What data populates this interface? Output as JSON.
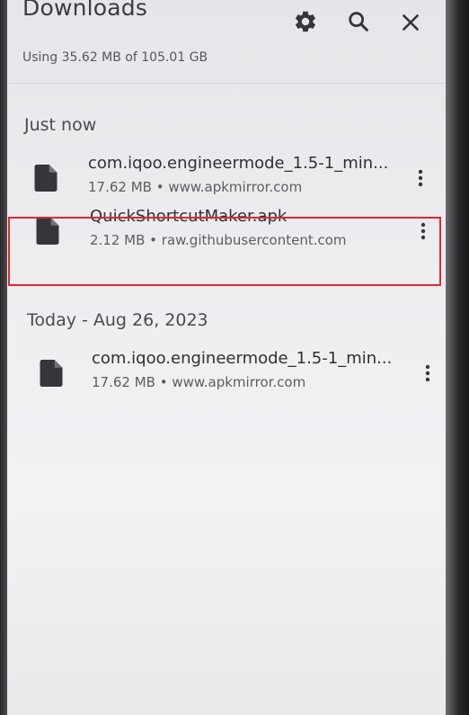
{
  "header": {
    "title": "Downloads",
    "storage_text": "Using 35.62 MB of 105.01 GB",
    "icons": [
      "gear-icon",
      "search-icon",
      "close-icon"
    ]
  },
  "sections": [
    {
      "header": "Just now",
      "items": [
        {
          "name": "com.iqoo.engineermode_1.5-1_min...",
          "meta": "17.62 MB • www.apkmirror.com",
          "icon": "file-icon"
        },
        {
          "name": "QuickShortcutMaker.apk",
          "meta": "2.12 MB • raw.githubusercontent.com",
          "icon": "file-icon",
          "highlighted": true,
          "highlight_color": "#e5262c"
        }
      ]
    },
    {
      "header": "Today - Aug 26, 2023",
      "items": [
        {
          "name": "com.iqoo.engineermode_1.5-1_min...",
          "meta": "17.62 MB • www.apkmirror.com",
          "icon": "file-icon"
        }
      ]
    }
  ],
  "colors": {
    "highlight": "#e5262c",
    "icon": "#35363c",
    "text_primary": "#2f3035"
  }
}
